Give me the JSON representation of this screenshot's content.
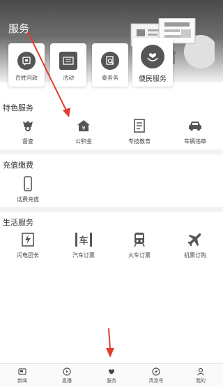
{
  "header": {
    "title": "服务"
  },
  "top_tiles": [
    {
      "label": "百姓问政",
      "icon": "chat-doc-icon"
    },
    {
      "label": "活动",
      "icon": "ticket-icon"
    },
    {
      "label": "泰务务",
      "icon": "search-doc-icon"
    },
    {
      "label": "便民服务",
      "icon": "hands-heart-icon"
    }
  ],
  "sections": {
    "featured": {
      "title": "特色服务",
      "items": [
        {
          "label": "督查",
          "icon": "badge-icon"
        },
        {
          "label": "公积金",
          "icon": "house-yen-icon"
        },
        {
          "label": "专技教育",
          "icon": "book-icon"
        },
        {
          "label": "车辆违章",
          "icon": "car-icon"
        }
      ]
    },
    "recharge": {
      "title": "充值缴费",
      "items": [
        {
          "label": "话费充值",
          "icon": "phone-icon"
        }
      ]
    },
    "life": {
      "title": "生活服务",
      "items": [
        {
          "label": "闪电团长",
          "icon": "bolt-icon"
        },
        {
          "label": "汽车订票",
          "icon": "bus-ticket-icon"
        },
        {
          "label": "火车订票",
          "icon": "train-icon"
        },
        {
          "label": "机票订购",
          "icon": "plane-icon"
        }
      ],
      "bus_text": "车"
    }
  },
  "tabbar": [
    {
      "label": "新闻",
      "icon": "news-icon"
    },
    {
      "label": "直播",
      "icon": "play-icon"
    },
    {
      "label": "服务",
      "icon": "service-heart-icon"
    },
    {
      "label": "清流号",
      "icon": "compass-icon"
    },
    {
      "label": "我的",
      "icon": "user-icon"
    }
  ],
  "colors": {
    "accent": "#e03c31",
    "icon": "#555555",
    "banner_dark": "#4a4a4a"
  }
}
